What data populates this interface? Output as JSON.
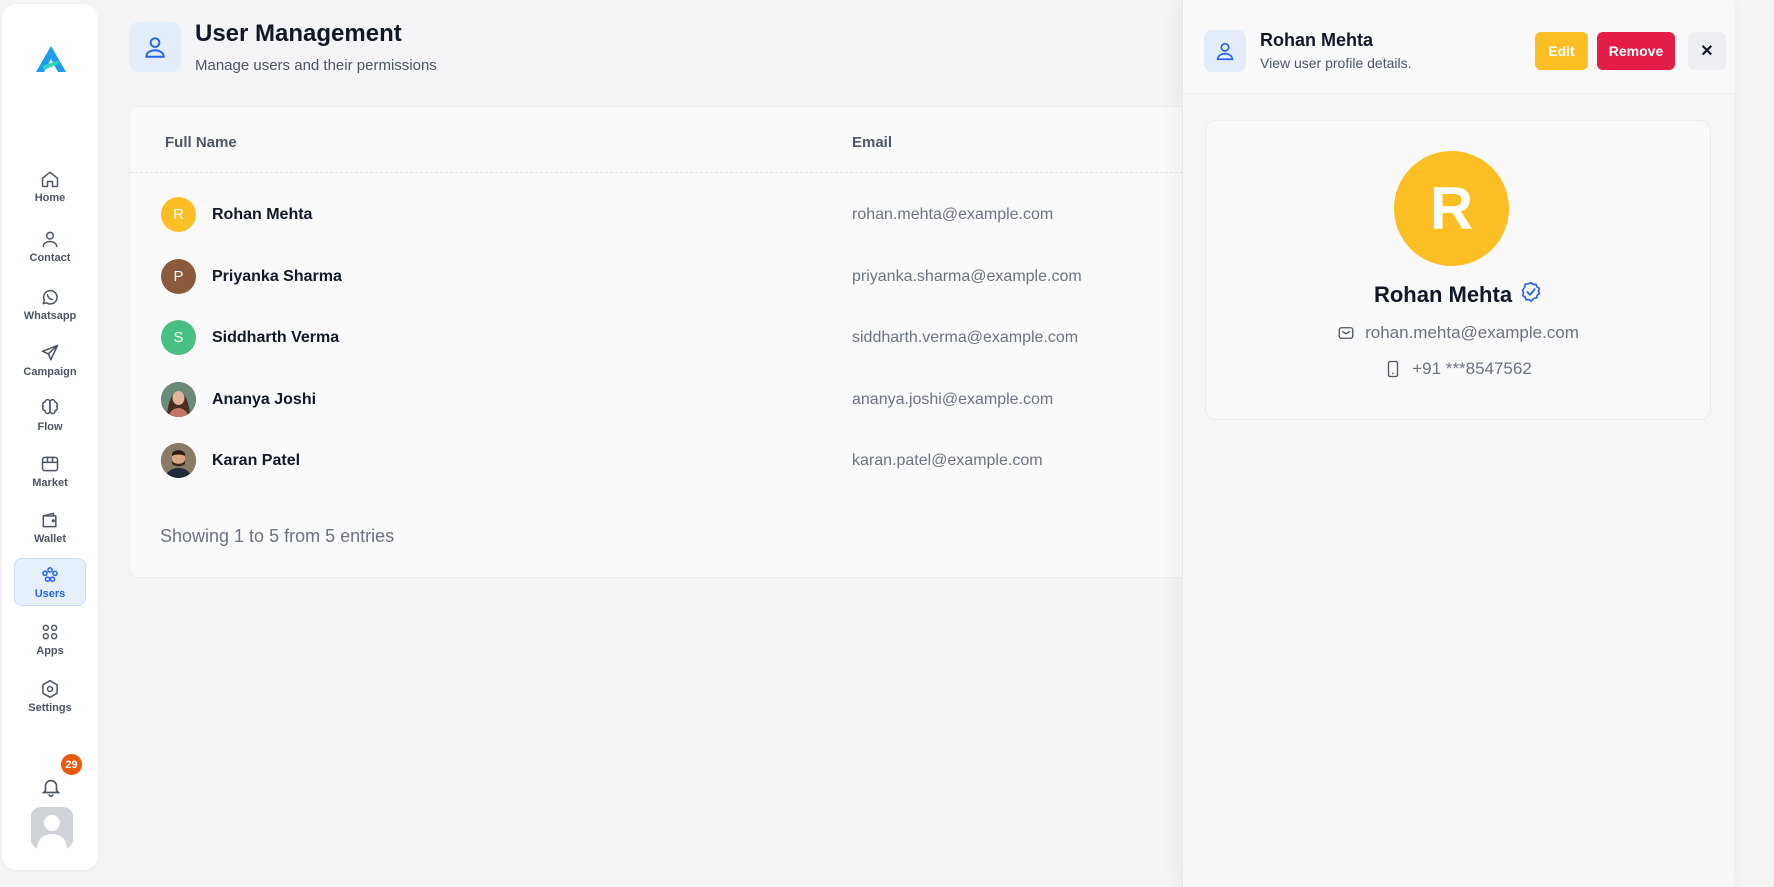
{
  "sidebar": {
    "logo": "app-logo",
    "items": [
      {
        "label": "Home",
        "icon": "home-icon"
      },
      {
        "label": "Contact",
        "icon": "contact-icon"
      },
      {
        "label": "Whatsapp",
        "icon": "whatsapp-icon"
      },
      {
        "label": "Campaign",
        "icon": "send-icon"
      },
      {
        "label": "Flow",
        "icon": "brain-icon"
      },
      {
        "label": "Market",
        "icon": "store-icon"
      },
      {
        "label": "Wallet",
        "icon": "wallet-icon"
      },
      {
        "label": "Users",
        "icon": "users-icon",
        "active": true
      },
      {
        "label": "Apps",
        "icon": "apps-icon"
      },
      {
        "label": "Settings",
        "icon": "settings-icon"
      }
    ],
    "notifications_count": "29"
  },
  "header": {
    "title": "User Management",
    "subtitle": "Manage users and their permissions"
  },
  "table": {
    "columns": [
      "Full Name",
      "Email"
    ],
    "rows": [
      {
        "initial": "R",
        "name": "Rohan Mehta",
        "email": "rohan.mehta@example.com",
        "color": "#fbbf24"
      },
      {
        "initial": "P",
        "name": "Priyanka Sharma",
        "email": "priyanka.sharma@example.com",
        "color": "#8b5a3c"
      },
      {
        "initial": "S",
        "name": "Siddharth Verma",
        "email": "siddharth.verma@example.com",
        "color": "#48c081"
      },
      {
        "initial": "",
        "name": "Ananya Joshi",
        "email": "ananya.joshi@example.com",
        "color": "#7a5548"
      },
      {
        "initial": "",
        "name": "Karan Patel",
        "email": "karan.patel@example.com",
        "color": "#5b4636"
      }
    ],
    "footer": "Showing 1 to 5 from 5 entries"
  },
  "panel": {
    "name": "Rohan Mehta",
    "subtitle": "View user profile details.",
    "edit_label": "Edit",
    "remove_label": "Remove",
    "close_label": "✕",
    "avatar_initial": "R",
    "email": "rohan.mehta@example.com",
    "phone": "+91 ***8547562"
  },
  "colors": {
    "accent": "#2563eb",
    "edit": "#fbbf24",
    "remove": "#e11d48",
    "badge": "#ea580c"
  }
}
